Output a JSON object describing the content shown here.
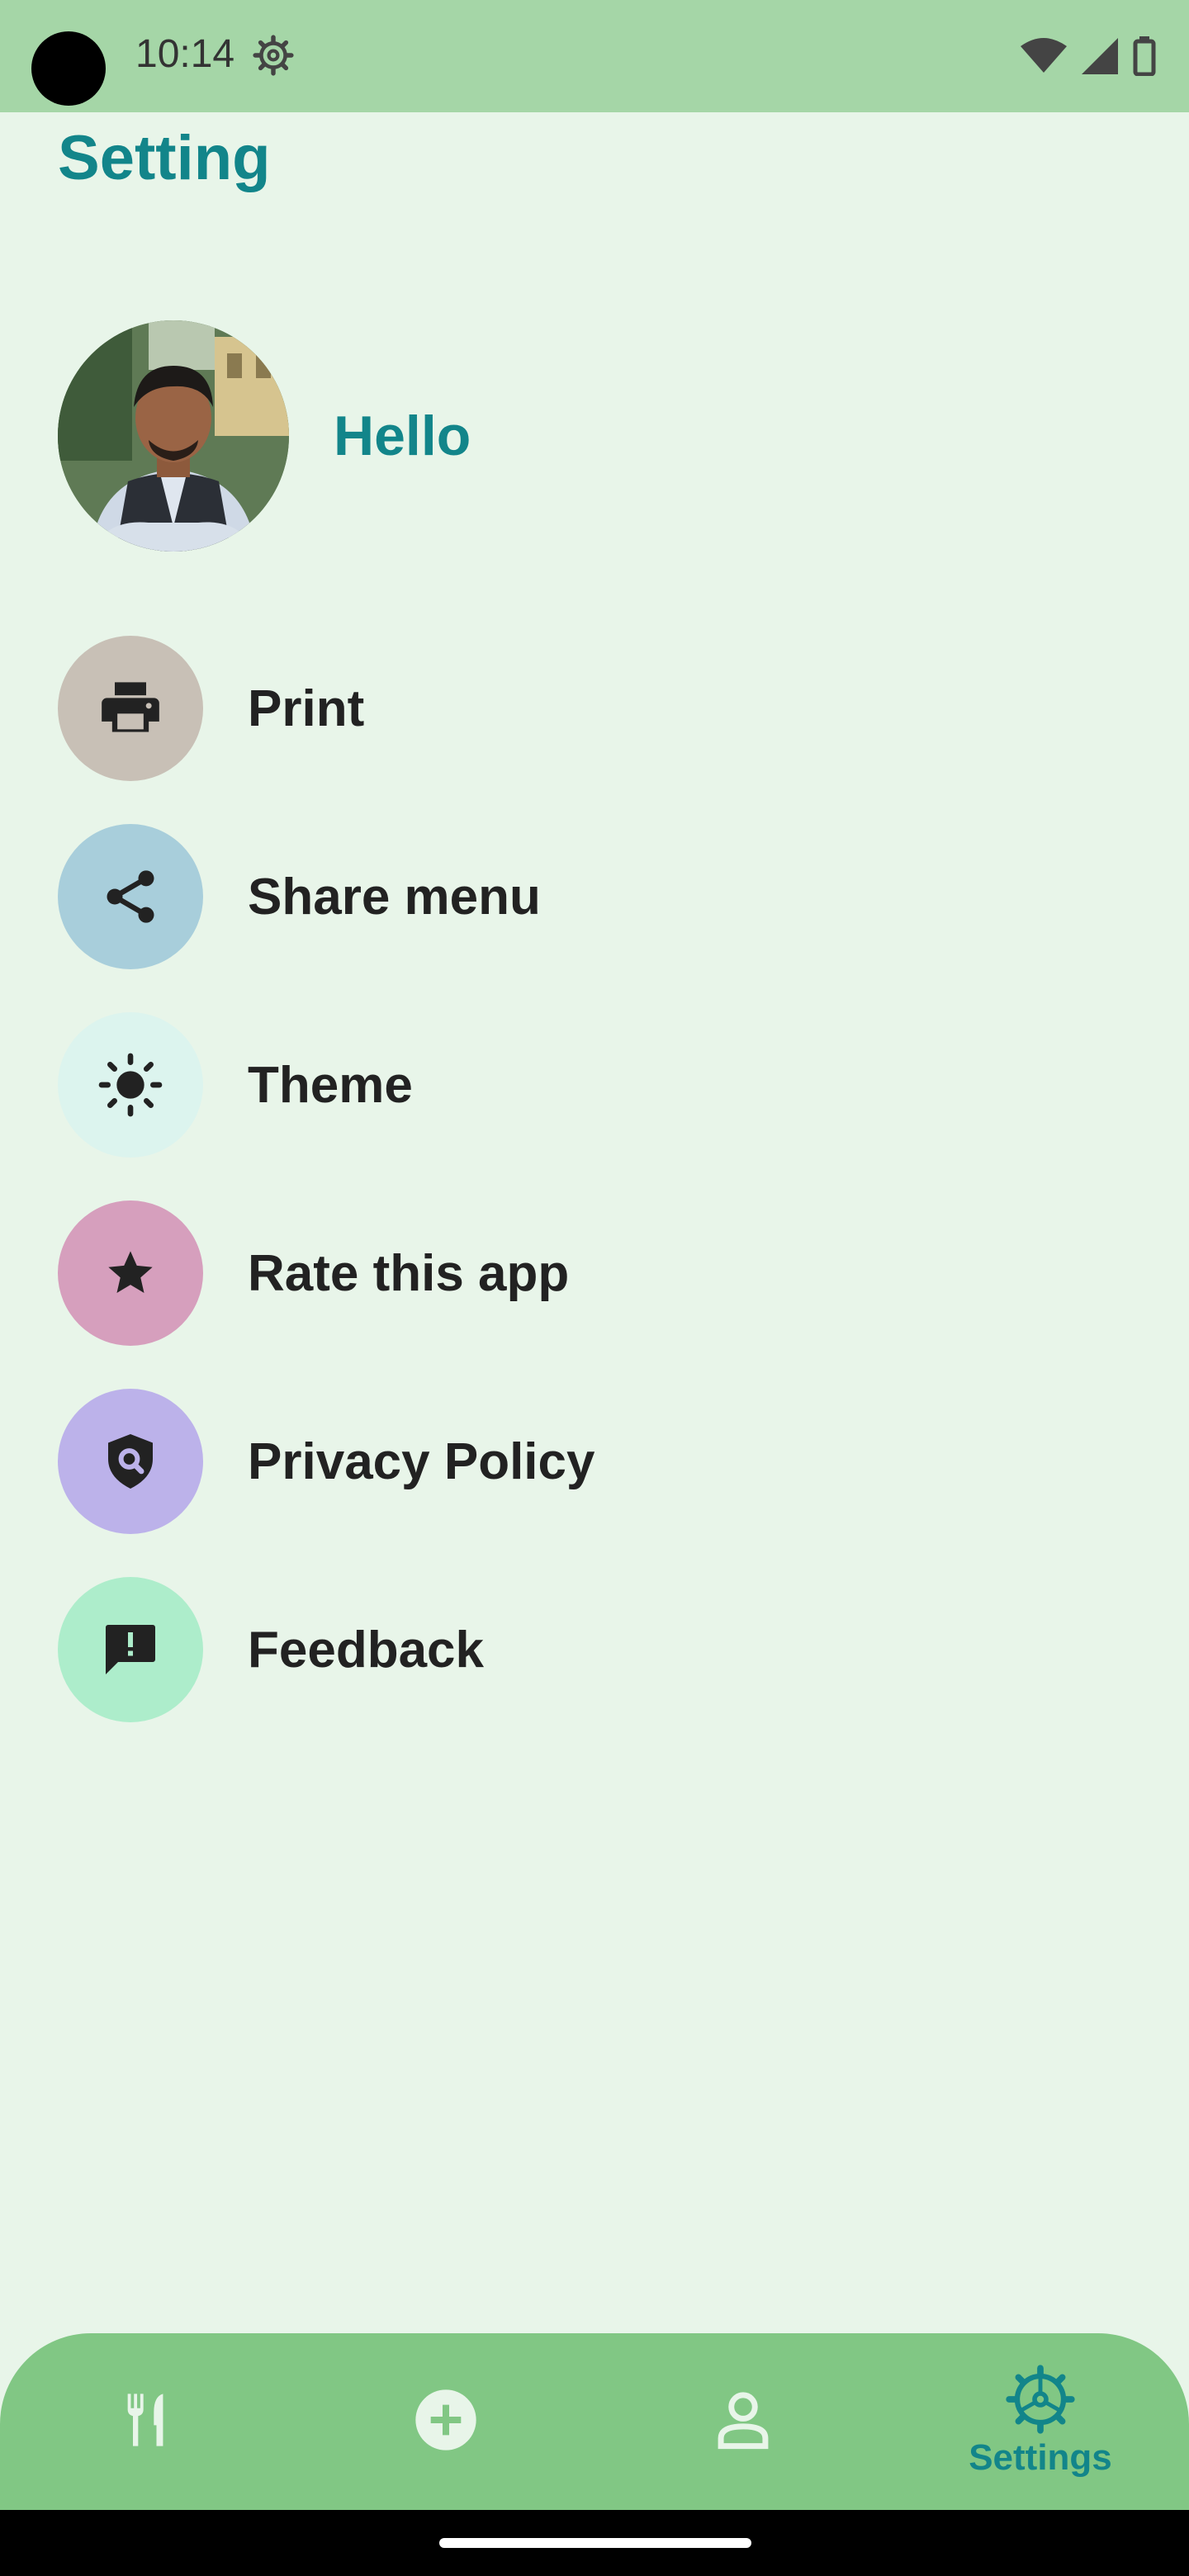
{
  "status_bar": {
    "time": "10:14",
    "icons": [
      "settings-icon",
      "wifi-icon",
      "cellular-signal-icon",
      "battery-icon"
    ]
  },
  "page": {
    "title": "Setting"
  },
  "profile": {
    "greeting": "Hello",
    "avatar": "user-photo"
  },
  "menu": {
    "items": [
      {
        "label": "Print",
        "icon": "print-icon",
        "color": "#c8c0b6"
      },
      {
        "label": "Share menu",
        "icon": "share-icon",
        "color": "#a8cedb"
      },
      {
        "label": "Theme",
        "icon": "sun-icon",
        "color": "#dcf4ee"
      },
      {
        "label": "Rate this app",
        "icon": "star-icon",
        "color": "#d69fbd"
      },
      {
        "label": "Privacy Policy",
        "icon": "privacy-shield-icon",
        "color": "#bcb2ea"
      },
      {
        "label": "Feedback",
        "icon": "feedback-icon",
        "color": "#adedcb"
      }
    ]
  },
  "bottom_nav": {
    "items": [
      {
        "icon": "restaurant-icon",
        "label": ""
      },
      {
        "icon": "add-circle-icon",
        "label": ""
      },
      {
        "icon": "person-icon",
        "label": ""
      },
      {
        "icon": "settings-icon",
        "label": "Settings",
        "active": true
      }
    ]
  },
  "colors": {
    "accent": "#12858a",
    "background": "#e8f5e9",
    "status_bar": "#a5d6a7",
    "nav_bar": "#81c784"
  }
}
